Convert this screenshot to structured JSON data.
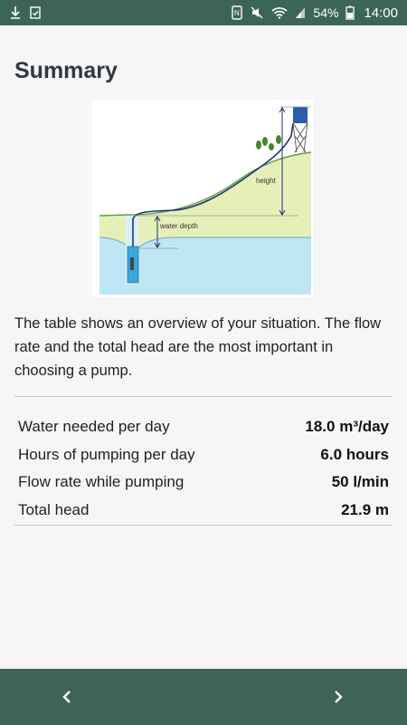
{
  "status_bar": {
    "battery_percent": "54%",
    "time": "14:00",
    "icons": [
      "download-icon",
      "clipboard-check-icon",
      "nfc-icon",
      "mute-icon",
      "wifi-icon",
      "signal-icon",
      "battery-icon"
    ]
  },
  "page": {
    "title": "Summary",
    "figure_labels": {
      "height": "height",
      "water_depth": "water depth"
    },
    "intro": "The table shows an overview of your situation. The flow rate and the total head are the most important in choosing a pump."
  },
  "summary_table": [
    {
      "label": "Water needed per day",
      "value": "18.0 m³/day"
    },
    {
      "label": "Hours of pumping per day",
      "value": "6.0 hours"
    },
    {
      "label": "Flow rate while pumping",
      "value": "50 l/min"
    },
    {
      "label": "Total head",
      "value": "21.9 m"
    }
  ],
  "nav": {
    "prev_icon": "chevron-left-icon",
    "next_icon": "chevron-right-icon"
  },
  "colors": {
    "bar": "#3c6558",
    "ground": "#e6efb8",
    "water": "#bfe6f5",
    "pipe": "#1f2f7a"
  }
}
